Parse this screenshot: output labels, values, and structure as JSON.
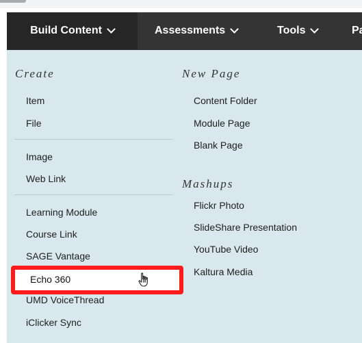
{
  "nav": {
    "items": [
      {
        "label": "Build Content"
      },
      {
        "label": "Assessments"
      },
      {
        "label": "Tools"
      },
      {
        "label": "Pa"
      }
    ]
  },
  "menu": {
    "left": {
      "create_heading": "Create",
      "create_items": [
        "Item",
        "File",
        "Image",
        "Web Link",
        "Learning Module",
        "Course Link",
        "SAGE Vantage",
        "Echo 360",
        "UMD VoiceThread",
        "iClicker Sync"
      ]
    },
    "right": {
      "new_page_heading": "New Page",
      "new_page_items": [
        "Content Folder",
        "Module Page",
        "Blank Page"
      ],
      "mashups_heading": "Mashups",
      "mashups_items": [
        "Flickr Photo",
        "SlideShare Presentation",
        "YouTube Video",
        "Kaltura Media"
      ]
    }
  },
  "colors": {
    "nav_bg": "#343434",
    "nav_active_bg": "#262626",
    "menu_bg": "#d8e8ed",
    "highlight": "#ff1b1b"
  }
}
